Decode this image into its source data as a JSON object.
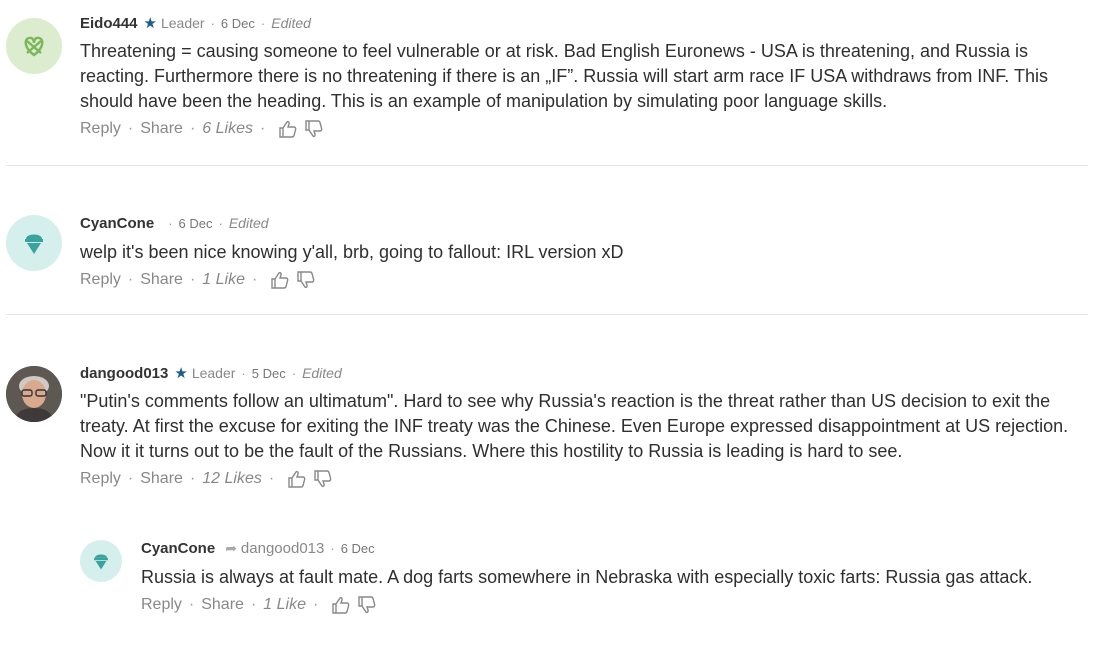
{
  "comments": [
    {
      "author": "Eido444",
      "role": "Leader",
      "date": "6 Dec",
      "edited": "Edited",
      "text": "Threatening = causing someone to feel vulnerable or at risk. Bad English Euronews - USA is threatening, and Russia is reacting. Furthermore there is no threatening if there is an „IF”. Russia will start arm race IF USA withdraws from INF. This should have been the heading. This is an example of manipulation by simulating poor language skills.",
      "reply_label": "Reply",
      "share_label": "Share",
      "likes": "6 Likes",
      "avatar_icon": "pretzel-icon",
      "avatar_color": "#dbeccf"
    },
    {
      "author": "CyanCone",
      "date": "6 Dec",
      "edited": "Edited",
      "text": "welp it's  been nice knowing y'all, brb, going to fallout: IRL version xD",
      "reply_label": "Reply",
      "share_label": "Share",
      "likes": "1 Like",
      "avatar_icon": "ice-cream-icon",
      "avatar_color": "#d5efed"
    },
    {
      "author": "dangood013",
      "role": "Leader",
      "date": "5 Dec",
      "edited": "Edited",
      "text": "\"Putin's comments follow an ultimatum\". Hard to see why Russia's reaction is the threat rather than US decision to exit the treaty. At first the excuse for exiting the INF treaty was the Chinese. Even Europe expressed disappointment at US rejection. Now it it turns out to be the fault of the Russians. Where this hostility to Russia is leading is hard to see.",
      "reply_label": "Reply",
      "share_label": "Share",
      "likes": "12 Likes",
      "avatar_icon": "user-photo"
    },
    {
      "author": "CyanCone",
      "reply_to": "dangood013",
      "date": "6 Dec",
      "text": "Russia is always at fault mate. A dog farts somewhere in Nebraska with especially toxic farts: Russia gas attack.",
      "reply_label": "Reply",
      "share_label": "Share",
      "likes": "1 Like",
      "avatar_icon": "ice-cream-icon",
      "avatar_color": "#d5efed"
    }
  ]
}
